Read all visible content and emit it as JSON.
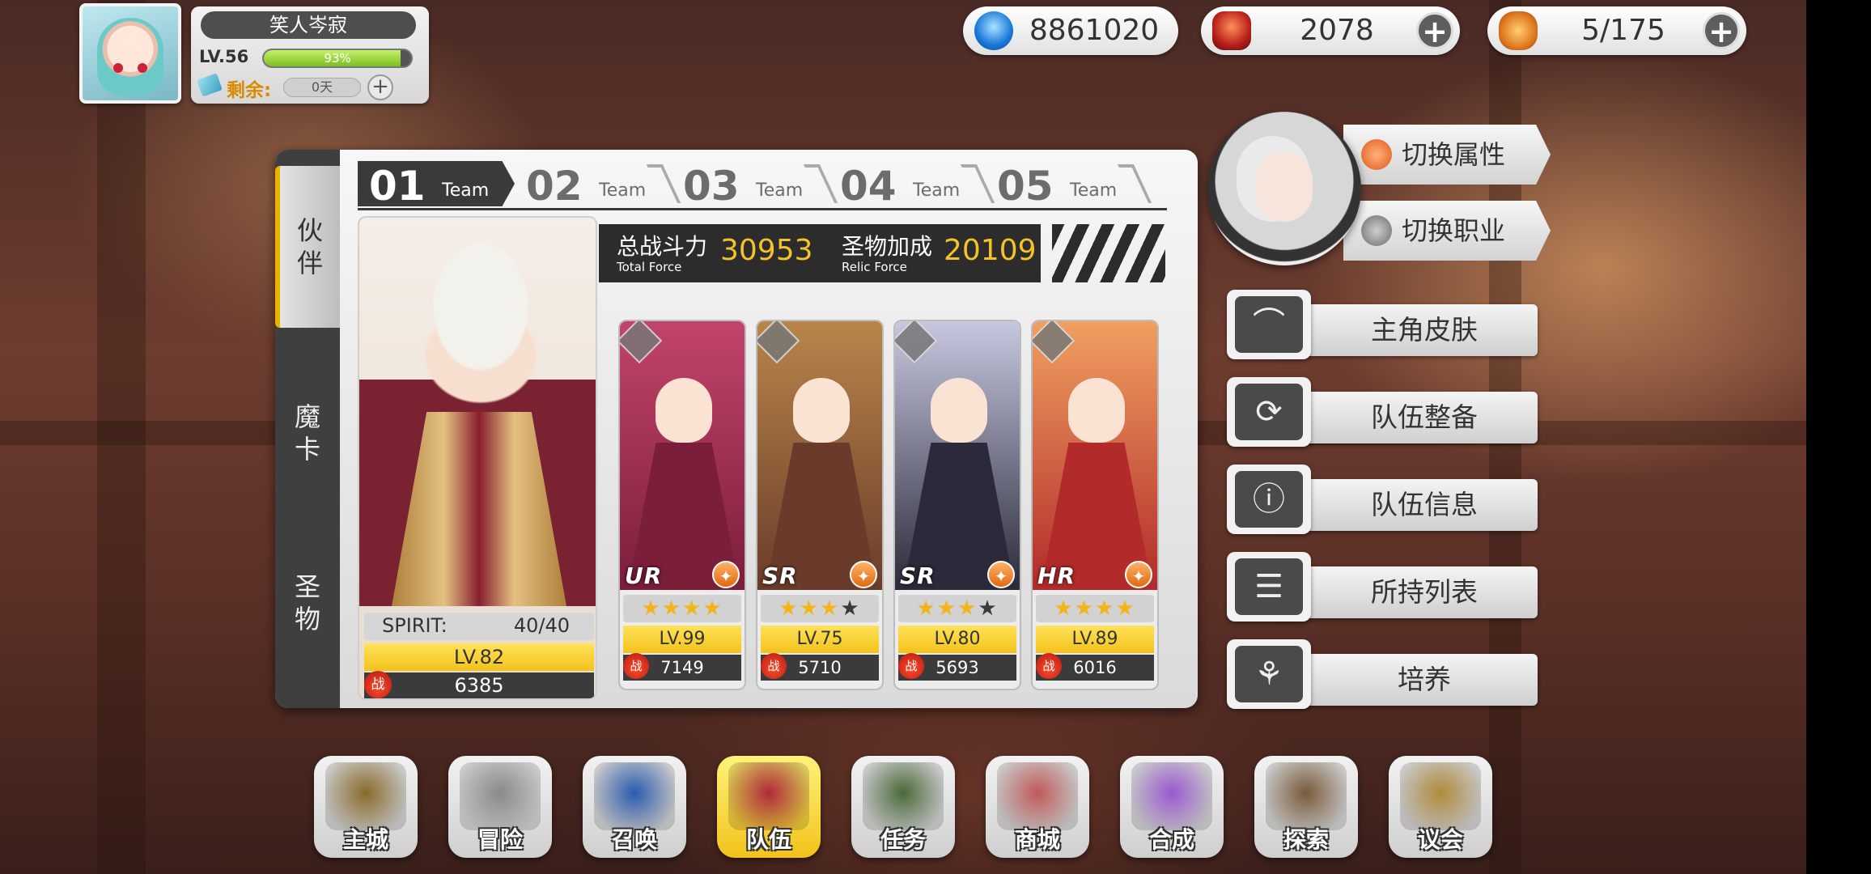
{
  "profile": {
    "name": "笑人岑寂",
    "level": "LV.56",
    "xp_percent": 93,
    "xp_text": "93%",
    "remain_label": "剩余:",
    "remain_value": "0天",
    "plus": "+"
  },
  "currencies": [
    {
      "name": "crystal",
      "icon": "blue-crystal-icon",
      "value": "8861020",
      "has_plus": false
    },
    {
      "name": "ruby",
      "icon": "red-gem-icon",
      "value": "2078",
      "has_plus": true
    },
    {
      "name": "stamina",
      "icon": "hotdog-icon",
      "value": "5/175",
      "has_plus": true
    }
  ],
  "side_tabs": [
    {
      "label": "伙\n伴",
      "active": true
    },
    {
      "label": "魔\n卡",
      "active": false
    },
    {
      "label": "圣\n物",
      "active": false
    }
  ],
  "team_tabs": [
    {
      "num": "01",
      "label": "Team",
      "active": true
    },
    {
      "num": "02",
      "label": "Team",
      "active": false
    },
    {
      "num": "03",
      "label": "Team",
      "active": false
    },
    {
      "num": "04",
      "label": "Team",
      "active": false
    },
    {
      "num": "05",
      "label": "Team",
      "active": false
    }
  ],
  "force": {
    "total_label": "总战斗力",
    "total_sub": "Total Force",
    "total_value": "30953",
    "relic_label": "圣物加成",
    "relic_sub": "Relic Force",
    "relic_value": "20109"
  },
  "leader": {
    "spirit_label": "SPIRIT:",
    "spirit_value": "40/40",
    "level": "LV.82",
    "power": "6385",
    "power_badge": "战"
  },
  "heroes": [
    {
      "rarity": "UR",
      "stars": 4,
      "max_stars": 4,
      "level": "LV.99",
      "power": "7149",
      "class_icon": "bow-class-icon",
      "colors": [
        "#7b1e3a",
        "#c2446a"
      ]
    },
    {
      "rarity": "SR",
      "stars": 3,
      "max_stars": 4,
      "level": "LV.75",
      "power": "5710",
      "class_icon": "cross-class-icon",
      "colors": [
        "#6a3b2a",
        "#b8864a"
      ]
    },
    {
      "rarity": "SR",
      "stars": 3,
      "max_stars": 4,
      "level": "LV.80",
      "power": "5693",
      "class_icon": "shield-class-icon",
      "colors": [
        "#2a2a3a",
        "#c7c7e0"
      ]
    },
    {
      "rarity": "HR",
      "stars": 4,
      "max_stars": 4,
      "level": "LV.89",
      "power": "6016",
      "class_icon": "cross-class-icon",
      "colors": [
        "#b22a2a",
        "#f0a060"
      ]
    }
  ],
  "hero_power_badge": "战",
  "switch_buttons": [
    {
      "label": "切换属性",
      "icon": "fire-attribute-icon"
    },
    {
      "label": "切换职业",
      "icon": "class-swap-icon"
    }
  ],
  "menu": [
    {
      "label": "主角皮肤",
      "icon": "hanger-icon",
      "glyph": "⌒"
    },
    {
      "label": "队伍整备",
      "icon": "refresh-icon",
      "glyph": "⟳"
    },
    {
      "label": "队伍信息",
      "icon": "team-info-icon",
      "glyph": "ⓘ"
    },
    {
      "label": "所持列表",
      "icon": "list-icon",
      "glyph": "☰"
    },
    {
      "label": "培养",
      "icon": "train-icon",
      "glyph": "⚘"
    }
  ],
  "bottom_nav": [
    {
      "label": "主城",
      "icon": "crown-castle-icon",
      "color": "#8a6a2a",
      "active": false
    },
    {
      "label": "冒险",
      "icon": "crossed-swords-icon",
      "color": "#8a8a8a",
      "active": false
    },
    {
      "label": "召唤",
      "icon": "summon-card-icon",
      "color": "#2a5ab0",
      "active": false
    },
    {
      "label": "队伍",
      "icon": "team-emblem-icon",
      "color": "#b02a3a",
      "active": true
    },
    {
      "label": "任务",
      "icon": "quest-book-icon",
      "color": "#4a6a3a",
      "active": false
    },
    {
      "label": "商城",
      "icon": "shop-tree-icon",
      "color": "#c05a5a",
      "active": false
    },
    {
      "label": "合成",
      "icon": "potion-icon",
      "color": "#9a5ad0",
      "active": false
    },
    {
      "label": "探索",
      "icon": "shovel-icon",
      "color": "#7a5a3a",
      "active": false
    },
    {
      "label": "议会",
      "icon": "council-chest-icon",
      "color": "#b08a3a",
      "active": false
    }
  ]
}
